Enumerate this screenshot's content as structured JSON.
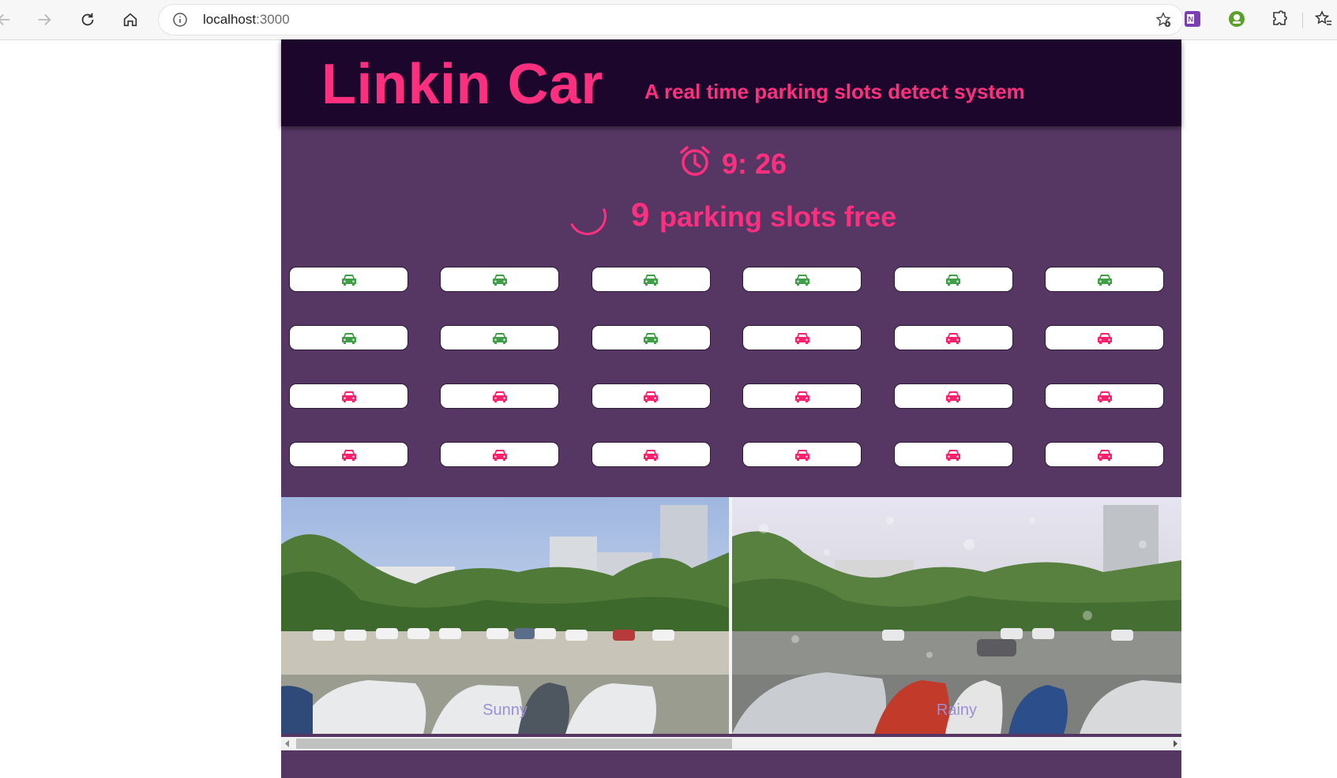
{
  "browser": {
    "url_host": "localhost",
    "url_port": ":3000",
    "icons": [
      "back-arrow-icon",
      "forward-arrow-icon",
      "reload-icon",
      "home-icon",
      "info-icon",
      "add-favorite-icon",
      "onenote-icon",
      "profile-extension-icon",
      "extensions-puzzle-icon",
      "favorites-icon"
    ]
  },
  "app": {
    "title": "Linkin Car",
    "tagline": "A real time parking slots detect system",
    "clock": {
      "time": "9: 26",
      "icon": "alarm-clock-icon"
    },
    "free": {
      "count": "9",
      "label": "parking slots free"
    },
    "colors": {
      "header_bg": "#1d062c",
      "body_bg": "#563764",
      "accent": "#ff2f7f",
      "free_car": "#3f9e47",
      "occupied_car": "#ff1f6a"
    },
    "slots": [
      "free",
      "free",
      "free",
      "free",
      "free",
      "free",
      "free",
      "free",
      "free",
      "occupied",
      "occupied",
      "occupied",
      "occupied",
      "occupied",
      "occupied",
      "occupied",
      "occupied",
      "occupied",
      "occupied",
      "occupied",
      "occupied",
      "occupied",
      "occupied",
      "occupied"
    ],
    "gallery": [
      {
        "caption": "Sunny"
      },
      {
        "caption": "Rainy"
      }
    ]
  }
}
